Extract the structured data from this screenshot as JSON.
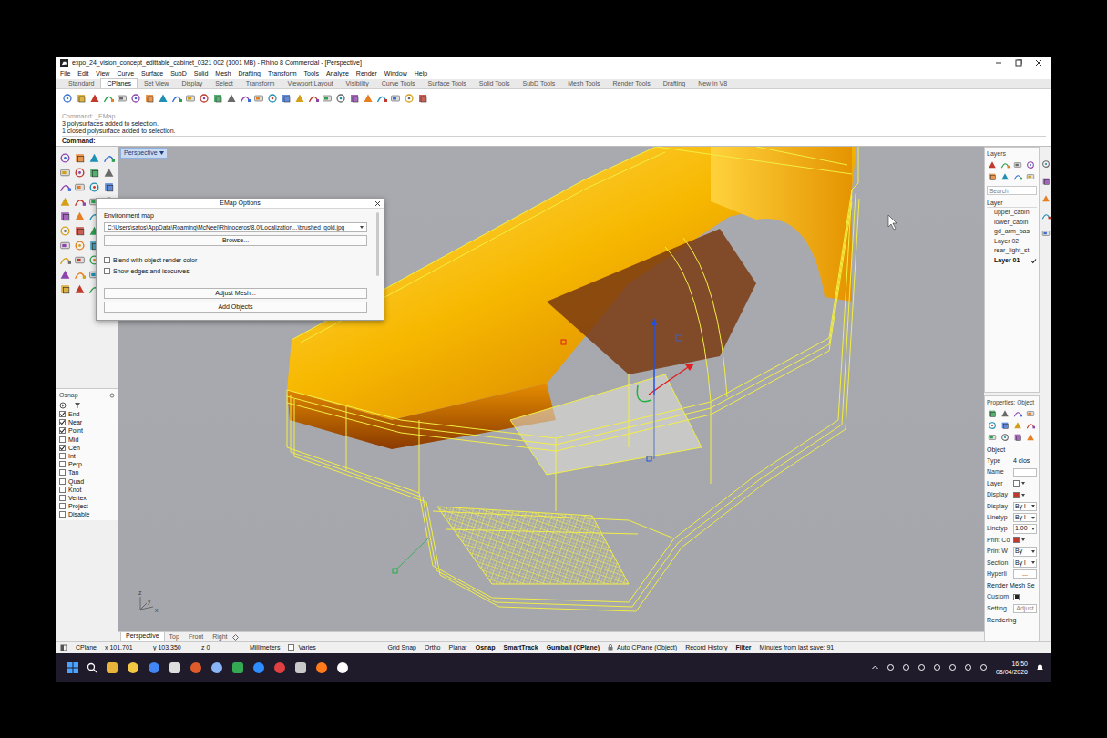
{
  "window": {
    "title": "expo_24_vision_concept_edittable_cabinet_0321 002 (1001 MB) - Rhino 8 Commercial - [Perspective]"
  },
  "menu": [
    "File",
    "Edit",
    "View",
    "Curve",
    "Surface",
    "SubD",
    "Solid",
    "Mesh",
    "Drafting",
    "Transform",
    "Tools",
    "Analyze",
    "Render",
    "Window",
    "Help"
  ],
  "toolbar_tabs": [
    {
      "label": "Standard",
      "selected": false
    },
    {
      "label": "CPlanes",
      "selected": true
    },
    {
      "label": "Set View",
      "selected": false
    },
    {
      "label": "Display",
      "selected": false
    },
    {
      "label": "Select",
      "selected": false
    },
    {
      "label": "Transform",
      "selected": false
    },
    {
      "label": "Viewport Layout",
      "selected": false
    },
    {
      "label": "Visibility",
      "selected": false
    },
    {
      "label": "Curve Tools",
      "selected": false
    },
    {
      "label": "Surface Tools",
      "selected": false
    },
    {
      "label": "Solid Tools",
      "selected": false
    },
    {
      "label": "SubD Tools",
      "selected": false
    },
    {
      "label": "Mesh Tools",
      "selected": false
    },
    {
      "label": "Render Tools",
      "selected": false
    },
    {
      "label": "Drafting",
      "selected": false
    },
    {
      "label": "New in V8",
      "selected": false
    }
  ],
  "command": {
    "history": [
      "Command: _EMap",
      "3 polysurfaces added to selection.",
      "1 closed polysurface added to selection."
    ],
    "prompt": "Command:"
  },
  "viewport": {
    "label": "Perspective",
    "axis_labels": [
      "z",
      "y",
      "x"
    ]
  },
  "emap": {
    "title": "EMap Options",
    "section": "Environment map",
    "path": "C:\\Users\\satos\\AppData\\Roaming\\McNeel\\Rhinoceros\\8.0\\Localization...\\brushed_gold.jpg",
    "browse": "Browse...",
    "options": [
      {
        "label": "Blend with object render color",
        "checked": false
      },
      {
        "label": "Show edges and isocurves",
        "checked": false
      }
    ],
    "buttons": [
      "Adjust Mesh...",
      "Add Objects"
    ]
  },
  "osnap": {
    "title": "Osnap",
    "items": [
      {
        "label": "End",
        "checked": true
      },
      {
        "label": "Near",
        "checked": true
      },
      {
        "label": "Point",
        "checked": true
      },
      {
        "label": "Mid",
        "checked": false
      },
      {
        "label": "Cen",
        "checked": true
      },
      {
        "label": "Int",
        "checked": false
      },
      {
        "label": "Perp",
        "checked": false
      },
      {
        "label": "Tan",
        "checked": false
      },
      {
        "label": "Quad",
        "checked": false
      },
      {
        "label": "Knot",
        "checked": false
      },
      {
        "label": "Vertex",
        "checked": false
      },
      {
        "label": "Project",
        "checked": false
      },
      {
        "label": "Disable",
        "checked": false
      }
    ]
  },
  "layers": {
    "title": "Layers",
    "search_placeholder": "Search",
    "header": "Layer",
    "items": [
      {
        "label": "upper_cabin",
        "current": false
      },
      {
        "label": "lower_cabin",
        "current": false
      },
      {
        "label": "gd_arm_bas",
        "current": false
      },
      {
        "label": "Layer 02",
        "current": false
      },
      {
        "label": "rear_light_st",
        "current": false
      },
      {
        "label": "Layer 01",
        "current": true
      }
    ]
  },
  "properties": {
    "title": "Properties: Object",
    "section": "Object",
    "rows": [
      {
        "label": "Type",
        "kind": "text",
        "value": "4 clos"
      },
      {
        "label": "Name",
        "kind": "field"
      },
      {
        "label": "Layer",
        "kind": "swatch",
        "color": "#ffffff"
      },
      {
        "label": "Display",
        "kind": "swatch",
        "color": "#c0392b"
      },
      {
        "label": "Display",
        "kind": "dropdown",
        "value": "By l"
      },
      {
        "label": "Linetyp",
        "kind": "dropdown",
        "value": "By l"
      },
      {
        "label": "Linetyp",
        "kind": "dropdown",
        "value": "1.00"
      },
      {
        "label": "Print Co",
        "kind": "swatch",
        "color": "#c0392b"
      },
      {
        "label": "Print W",
        "kind": "dropdown",
        "value": "By"
      },
      {
        "label": "Section",
        "kind": "dropdown",
        "value": "By l"
      },
      {
        "label": "Hyperli",
        "kind": "button",
        "value": "..."
      }
    ],
    "mesh_section": "Render Mesh Se",
    "mesh_rows": [
      {
        "label": "Custom",
        "kind": "checkbox",
        "checked": true
      },
      {
        "label": "Setting",
        "kind": "button",
        "value": "Adjust",
        "disabled": true
      }
    ],
    "next_section": "Rendering"
  },
  "viewport_tabs": [
    {
      "label": "Perspective",
      "selected": true
    },
    {
      "label": "Top",
      "selected": false
    },
    {
      "label": "Front",
      "selected": false
    },
    {
      "label": "Right",
      "selected": false
    }
  ],
  "status_bar": {
    "cplane": "CPlane",
    "x": "x 101.701",
    "y": "y 103.350",
    "z": "z 0",
    "units": "Millimeters",
    "layer": "Varies",
    "toggles": [
      {
        "label": "Grid Snap",
        "on": false,
        "kind": "toggle"
      },
      {
        "label": "Ortho",
        "on": false,
        "kind": "toggle"
      },
      {
        "label": "Planar",
        "on": false,
        "kind": "toggle"
      },
      {
        "label": "Osnap",
        "on": true,
        "kind": "toggle"
      },
      {
        "label": "SmartTrack",
        "on": true,
        "kind": "toggle"
      },
      {
        "label": "Gumball (CPlane)",
        "on": true,
        "kind": "toggle"
      },
      {
        "label": "Auto CPlane (Object)",
        "on": false,
        "kind": "lock"
      },
      {
        "label": "Record History",
        "on": false,
        "kind": "toggle"
      },
      {
        "label": "Filter",
        "on": true,
        "kind": "toggle"
      }
    ],
    "save": "Minutes from last save: 91"
  },
  "taskbar": {
    "time": "16:50",
    "date": "08/04/2026"
  }
}
